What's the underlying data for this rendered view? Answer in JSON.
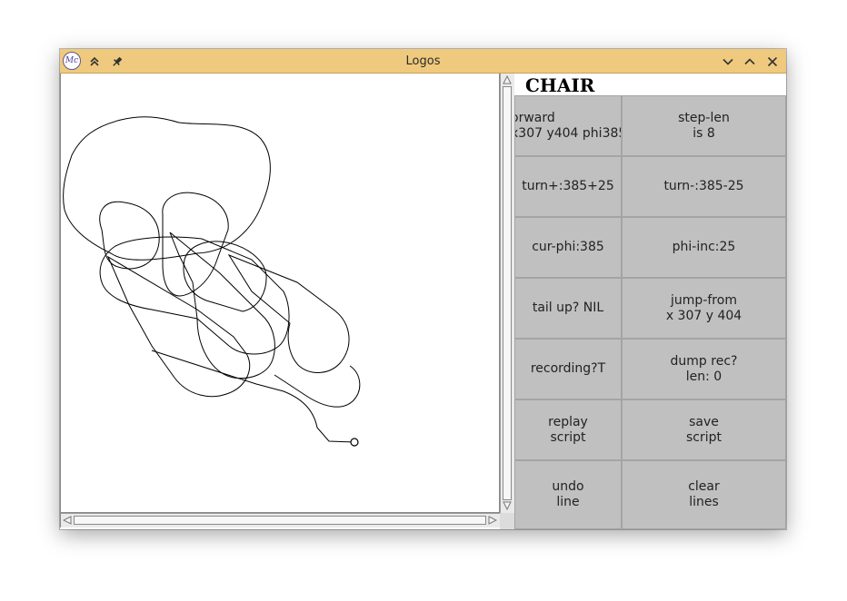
{
  "window": {
    "title": "Logos",
    "app_logo_text": "Mc"
  },
  "panel": {
    "title": "CHAIR",
    "buttons": [
      {
        "label": "orward\nx307 y404 phi385"
      },
      {
        "label": "step-len\nis 8"
      },
      {
        "label": "turn+:385+25"
      },
      {
        "label": "turn-:385-25"
      },
      {
        "label": "cur-phi:385"
      },
      {
        "label": "phi-inc:25"
      },
      {
        "label": "tail up? NIL"
      },
      {
        "label": "jump-from\nx 307 y 404"
      },
      {
        "label": "recording?T"
      },
      {
        "label": "dump rec?\nlen: 0"
      },
      {
        "label": "replay\nscript"
      },
      {
        "label": "save\nscript"
      },
      {
        "label": "undo\nline"
      },
      {
        "label": "clear\nlines"
      }
    ]
  },
  "colors": {
    "titlebar": "#efca7e",
    "panel_bg": "#c0c0c0",
    "canvas_bg": "#ffffff",
    "drawing_stroke": "#000000"
  },
  "icons": {
    "app": "mc-logo-icon",
    "shade": "double-chevron-up-icon",
    "pin": "pin-icon",
    "minimize": "chevron-down-icon",
    "maximize": "chevron-up-icon",
    "close": "close-icon"
  }
}
